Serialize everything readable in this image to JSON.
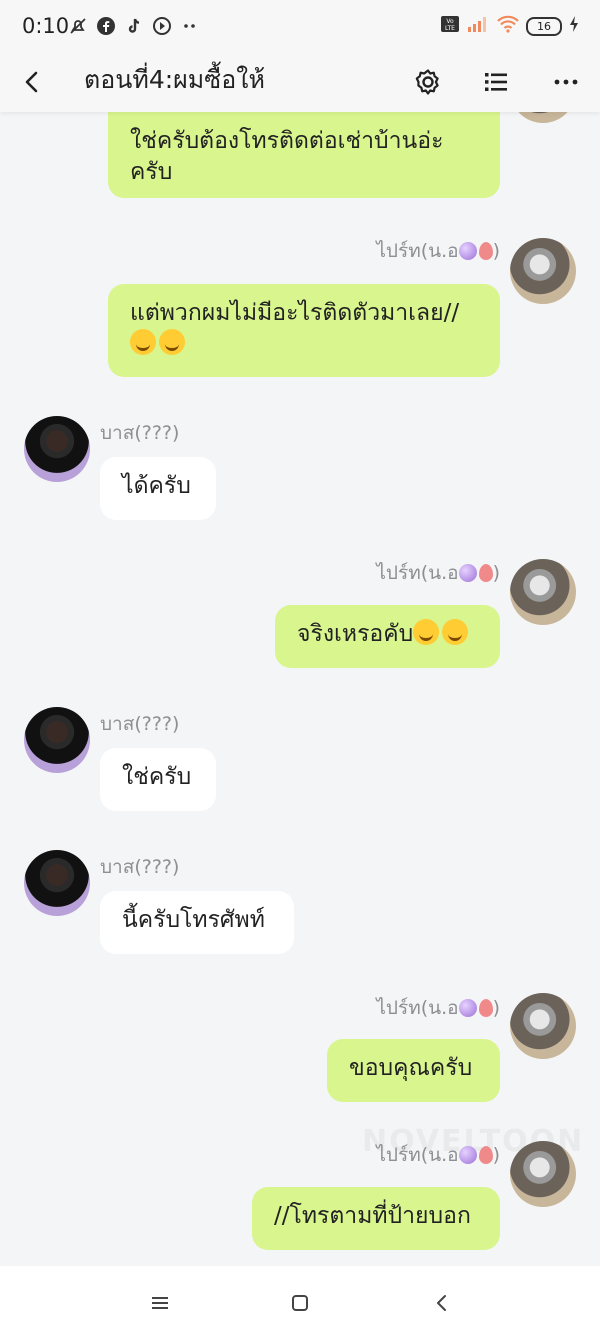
{
  "status_bar": {
    "time": "0:10",
    "icons_left": [
      "muted-notification-icon",
      "facebook-icon",
      "tiktok-icon",
      "play-circle-icon",
      "more-dots-icon"
    ],
    "icons_right": [
      "volte-icon",
      "signal-icon",
      "wifi-icon",
      "battery-icon",
      "charging-icon"
    ],
    "battery_level": "16"
  },
  "header": {
    "title": "ตอนที่4:ผมซื้อให้",
    "back_icon": "back-chevron-icon",
    "settings_icon": "gear-icon",
    "list_icon": "list-icon",
    "more_icon": "more-dots-icon"
  },
  "messages": [
    {
      "side": "right",
      "text": "ใช่ครับต้องโทรติดต่อเช่าบ้านอ่ะครับ"
    },
    {
      "side": "right",
      "name": "ไปร์ท(น.อ",
      "name_suffix": ")",
      "text": "แต่พวกผมไม่มีอะไรติดตัวมาเลย//"
    },
    {
      "side": "left",
      "name": "บาส(???)",
      "text": "ได้ครับ"
    },
    {
      "side": "right",
      "name": "ไปร์ท(น.อ",
      "name_suffix": ")",
      "text": "จริงเหรอคับ"
    },
    {
      "side": "left",
      "name": "บาส(???)",
      "text": "ใช่ครับ"
    },
    {
      "side": "left",
      "name": "บาส(???)",
      "text": "นี้ครับโทรศัพท์"
    },
    {
      "side": "right",
      "name": "ไปร์ท(น.อ",
      "name_suffix": ")",
      "text": "ขอบคุณครับ"
    },
    {
      "side": "right",
      "name": "ไปร์ท(น.อ",
      "name_suffix": ")",
      "text": "//โทรตามที่ป้ายบอก"
    }
  ],
  "watermark": "NOVELTOON",
  "colors": {
    "bubble_right": "#d9f58e",
    "bubble_left": "#ffffff",
    "background": "#f4f5f7"
  },
  "navbar": {
    "icons": [
      "menu-icon",
      "home-square-icon",
      "back-triangle-icon"
    ]
  }
}
